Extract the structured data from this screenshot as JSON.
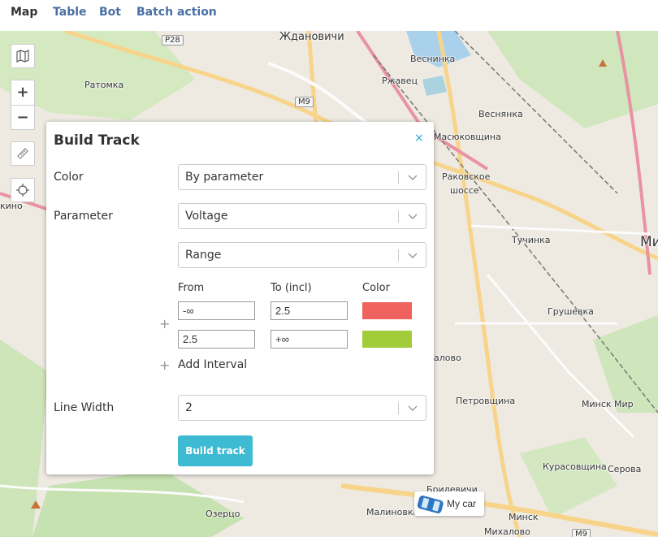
{
  "tabs": [
    {
      "label": "Map",
      "active": true
    },
    {
      "label": "Table",
      "active": false
    },
    {
      "label": "Bot",
      "active": false
    },
    {
      "label": "Batch action",
      "active": false
    }
  ],
  "map": {
    "labels": [
      "Ждановичи",
      "Веснинка",
      "Ратомка",
      "Ржавец",
      "Веснянка",
      "Масюковщина",
      "Раковское",
      "шоссе",
      "кино",
      "Тучинка",
      "Ми",
      "Грушевка",
      "алово",
      "Петровщина",
      "Минск Мир",
      "Курасовщина",
      "Серова",
      "Брилевичи",
      "Озерцо",
      "Малиновка",
      "Минск",
      "Михалово"
    ],
    "road_badges": [
      "P28",
      "M9",
      "M9"
    ],
    "controls": {
      "zoom_in": "+",
      "zoom_out": "−"
    }
  },
  "panel": {
    "title": "Build Track",
    "close": "×",
    "color_label": "Color",
    "color_value": "By parameter",
    "parameter_label": "Parameter",
    "parameter_value": "Voltage",
    "mode_value": "Range",
    "headers": {
      "from": "From",
      "to": "To (incl)",
      "color": "Color"
    },
    "intervals": [
      {
        "from": "-∞",
        "to": "2.5",
        "color": "#f0625d"
      },
      {
        "from": "2.5",
        "to": "+∞",
        "color": "#a3cc3b"
      }
    ],
    "plus": "+",
    "add_interval": "Add Interval",
    "line_width_label": "Line Width",
    "line_width_value": "2",
    "build_button": "Build track"
  },
  "marker": {
    "label": "My car"
  }
}
